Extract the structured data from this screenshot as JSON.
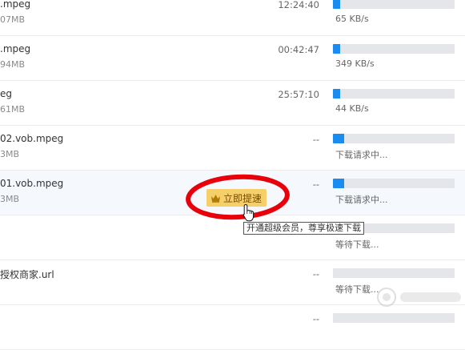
{
  "downloads": [
    {
      "name": ".mpeg",
      "size": "07MB",
      "time": "12:24:40",
      "progress": 0.06,
      "status": "65 KB/s"
    },
    {
      "name": ".mpeg",
      "size": "94MB",
      "time": "00:42:47",
      "progress": 0.06,
      "status": "349 KB/s"
    },
    {
      "name": "eg",
      "size": "61MB",
      "time": "25:57:10",
      "progress": 0.06,
      "status": "44 KB/s"
    },
    {
      "name": "02.vob.mpeg",
      "size": "3MB",
      "time": "--",
      "progress": 0.09,
      "status": "下载请求中..."
    },
    {
      "name": "01.vob.mpeg",
      "size": "3MB",
      "time": "--",
      "progress": 0.09,
      "status": "下载请求中..."
    },
    {
      "name": "",
      "size": "",
      "time": "--",
      "progress": 0.0,
      "status": "等待下载..."
    },
    {
      "name": "授权商家.url",
      "size": "",
      "time": "--",
      "progress": 0.0,
      "status": "等待下载..."
    },
    {
      "name": "",
      "size": "",
      "time": "--",
      "progress": 0.0,
      "status": ""
    }
  ],
  "boost": {
    "label": "立即提速",
    "icon": "crown-icon"
  },
  "tooltip": {
    "text": "开通超级会员，尊享极速下载"
  },
  "colors": {
    "progress_fill": "#1a8cf0",
    "progress_track": "#e4e6ea",
    "boost_bg": "#f5cf6a",
    "annotation": "#e8000b"
  }
}
